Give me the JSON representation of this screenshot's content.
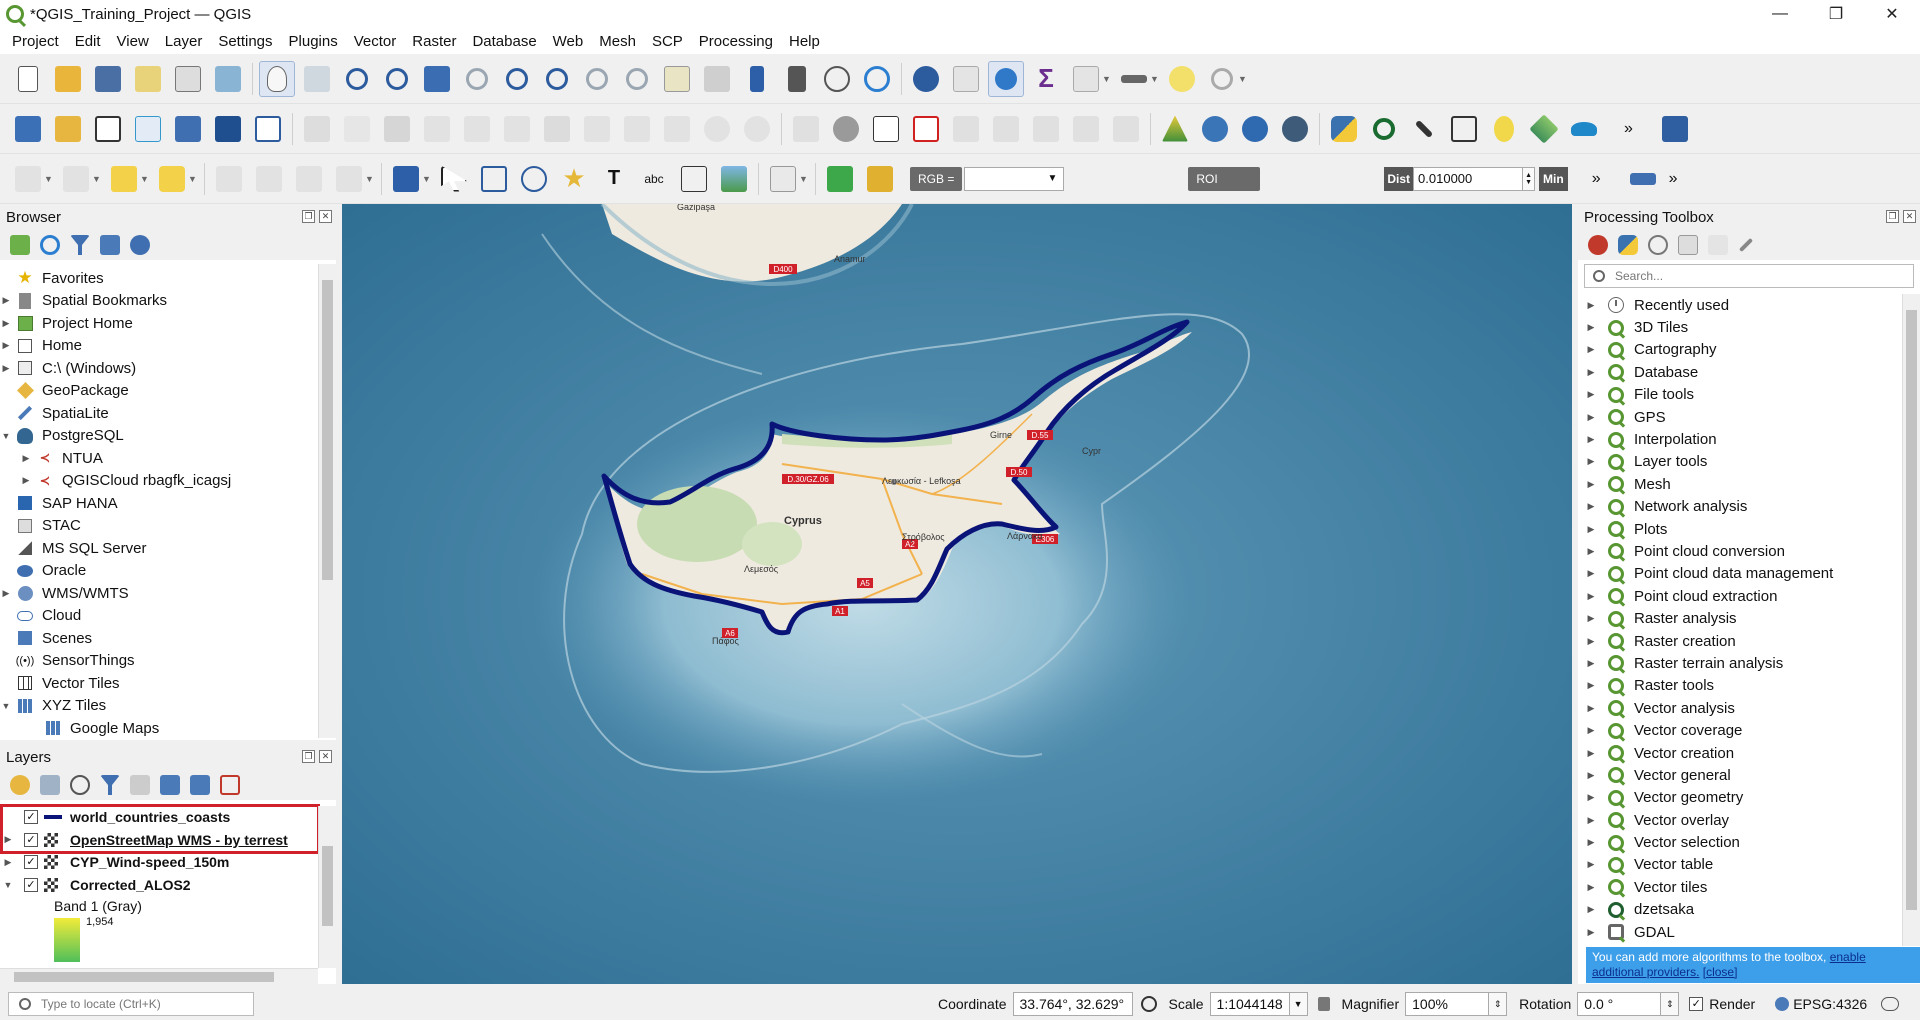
{
  "window": {
    "title": "*QGIS_Training_Project — QGIS",
    "minimize": "—",
    "restore": "❐",
    "close": "✕"
  },
  "menu": [
    "Project",
    "Edit",
    "View",
    "Layer",
    "Settings",
    "Plugins",
    "Vector",
    "Raster",
    "Database",
    "Web",
    "Mesh",
    "SCP",
    "Processing",
    "Help"
  ],
  "scp_toolbar": {
    "rgb_label": "RGB =",
    "roi_label": "ROI",
    "dist_label": "Dist",
    "dist_value": "0.010000",
    "min_label": "Min"
  },
  "browser": {
    "title": "Browser",
    "items": [
      {
        "label": "Favorites",
        "arrow": "",
        "icon": "star-icon"
      },
      {
        "label": "Spatial Bookmarks",
        "arrow": "▶",
        "icon": "bookmark-icon"
      },
      {
        "label": "Project Home",
        "arrow": "▶",
        "icon": "project-home-icon"
      },
      {
        "label": "Home",
        "arrow": "▶",
        "icon": "home-icon"
      },
      {
        "label": "C:\\ (Windows)",
        "arrow": "▶",
        "icon": "drive-icon"
      },
      {
        "label": "GeoPackage",
        "arrow": "",
        "icon": "geopackage-icon"
      },
      {
        "label": "SpatiaLite",
        "arrow": "",
        "icon": "spatialite-icon"
      },
      {
        "label": "PostgreSQL",
        "arrow": "▼",
        "icon": "postgresql-icon"
      },
      {
        "label": "NTUA",
        "arrow": "▶",
        "icon": "connection-icon",
        "indent": 1
      },
      {
        "label": "QGISCloud rbagfk_icagsj",
        "arrow": "▶",
        "icon": "connection-icon",
        "indent": 1
      },
      {
        "label": "SAP HANA",
        "arrow": "",
        "icon": "sap-hana-icon"
      },
      {
        "label": "STAC",
        "arrow": "",
        "icon": "stac-icon"
      },
      {
        "label": "MS SQL Server",
        "arrow": "",
        "icon": "mssql-icon"
      },
      {
        "label": "Oracle",
        "arrow": "",
        "icon": "oracle-icon"
      },
      {
        "label": "WMS/WMTS",
        "arrow": "▶",
        "icon": "wms-icon"
      },
      {
        "label": "Cloud",
        "arrow": "",
        "icon": "cloud-icon"
      },
      {
        "label": "Scenes",
        "arrow": "",
        "icon": "scenes-icon"
      },
      {
        "label": "SensorThings",
        "arrow": "",
        "icon": "sensorthings-icon"
      },
      {
        "label": "Vector Tiles",
        "arrow": "",
        "icon": "vector-tiles-icon"
      },
      {
        "label": "XYZ Tiles",
        "arrow": "▼",
        "icon": "xyz-tiles-icon"
      },
      {
        "label": "Google Maps",
        "arrow": "",
        "icon": "xyz-tiles-icon",
        "indent": 1
      }
    ]
  },
  "layers": {
    "title": "Layers",
    "items": [
      {
        "label": "world_countries_coasts",
        "checked": "✓",
        "arrow": "",
        "type": "line"
      },
      {
        "label": "OpenStreetMap WMS - by terrest",
        "checked": "✓",
        "arrow": "▶",
        "type": "raster",
        "underline": true
      },
      {
        "label": "CYP_Wind-speed_150m",
        "checked": "✓",
        "arrow": "▶",
        "type": "raster"
      },
      {
        "label": "Corrected_ALOS2",
        "checked": "✓",
        "arrow": "▼",
        "type": "raster"
      }
    ],
    "band_label": "Band 1 (Gray)",
    "legend_max": "1,954"
  },
  "processing": {
    "title": "Processing Toolbox",
    "search_placeholder": "Search...",
    "items": [
      "Recently used",
      "3D Tiles",
      "Cartography",
      "Database",
      "File tools",
      "GPS",
      "Interpolation",
      "Layer tools",
      "Mesh",
      "Network analysis",
      "Plots",
      "Point cloud conversion",
      "Point cloud data management",
      "Point cloud extraction",
      "Raster analysis",
      "Raster creation",
      "Raster terrain analysis",
      "Raster tools",
      "Vector analysis",
      "Vector coverage",
      "Vector creation",
      "Vector general",
      "Vector geometry",
      "Vector overlay",
      "Vector selection",
      "Vector table",
      "Vector tiles",
      "dzetsaka",
      "GDAL"
    ],
    "info_text": "You can add more algorithms to the toolbox, ",
    "info_link1": "enable additional providers.",
    "info_link2": "[close]"
  },
  "map": {
    "labels": {
      "gazipasa": "Gazipaşa",
      "anamur": "Anamur",
      "d400": "D400",
      "girne": "Girne",
      "lefkosa": "Λευκωσία - Lefkoşa",
      "strovolos": "Στρόβολος",
      "cyprus": "Cyprus",
      "pafos": "Πάφος",
      "larnaka": "Λάρνακα",
      "limassol": "Λεμεσός",
      "cypr": "Cypr",
      "d30": "D.30/GZ.06",
      "d55": "D.55",
      "d50": "D.50",
      "e306": "E306",
      "a2": "A2",
      "a5": "A5",
      "a1": "A1",
      "a6": "A6"
    }
  },
  "status": {
    "locator_placeholder": "Type to locate (Ctrl+K)",
    "coordinate_label": "Coordinate",
    "coordinate_value": "33.764°, 32.629°",
    "scale_label": "Scale",
    "scale_value": "1:1044148",
    "magnifier_label": "Magnifier",
    "magnifier_value": "100%",
    "rotation_label": "Rotation",
    "rotation_value": "0.0 °",
    "render_label": "Render",
    "crs": "EPSG:4326"
  }
}
